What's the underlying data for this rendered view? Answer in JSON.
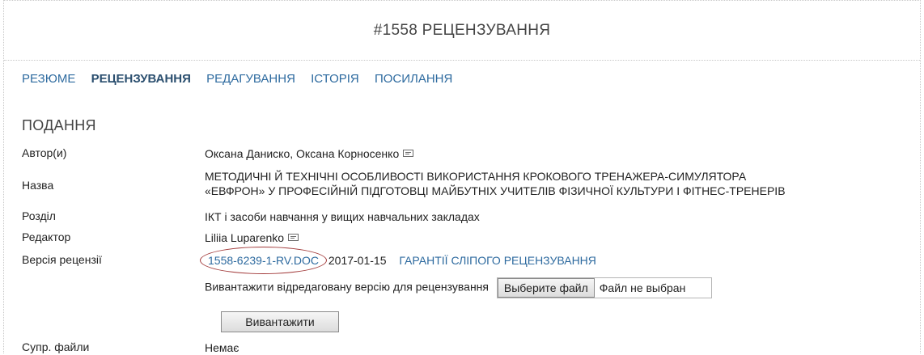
{
  "header": {
    "title": "#1558 РЕЦЕНЗУВАННЯ"
  },
  "tabs": [
    {
      "label": "РЕЗЮМЕ",
      "active": false
    },
    {
      "label": "РЕЦЕНЗУВАННЯ",
      "active": true
    },
    {
      "label": "РЕДАГУВАННЯ",
      "active": false
    },
    {
      "label": "ІСТОРІЯ",
      "active": false
    },
    {
      "label": "ПОСИЛАННЯ",
      "active": false
    }
  ],
  "submission": {
    "section_title": "ПОДАННЯ",
    "authors": {
      "label": "Автор(и)",
      "value": "Оксана Даниско, Оксана Корносенко"
    },
    "title": {
      "label": "Назва",
      "line1": "МЕТОДИЧНІ Й ТЕХНІЧНІ ОСОБЛИВОСТІ ВИКОРИСТАННЯ КРОКОВОГО ТРЕНАЖЕРА-СИМУЛЯТОРА",
      "line2": "«ЕВФРОН» У ПРОФЕСІЙНІЙ ПІДГОТОВЦІ МАЙБУТНІХ УЧИТЕЛІВ ФІЗИЧНОЇ КУЛЬТУРИ І ФІТНЕС-ТРЕНЕРІВ"
    },
    "section": {
      "label": "Розділ",
      "value": "ІКТ і засоби навчання у вищих навчальних закладах"
    },
    "editor": {
      "label": "Редактор",
      "value": "Liliia Luparenko"
    },
    "review_version": {
      "label": "Версія рецензії",
      "file": "1558-6239-1-RV.DOC",
      "date": "2017-01-15",
      "blind_link": "ГАРАНТІЇ СЛІПОГО РЕЦЕНЗУВАННЯ"
    },
    "upload": {
      "label": "Вивантажити відредаговану версію для рецензування",
      "choose_button": "Выберите файл",
      "file_status": "Файл не выбран",
      "upload_button": "Вивантажити"
    },
    "supp_files": {
      "label": "Супр. файли",
      "value": "Немає"
    }
  },
  "icons": {
    "email": "envelope-icon"
  },
  "colors": {
    "link": "#2d6a9f",
    "annotation_circle": "#a23a3a"
  }
}
